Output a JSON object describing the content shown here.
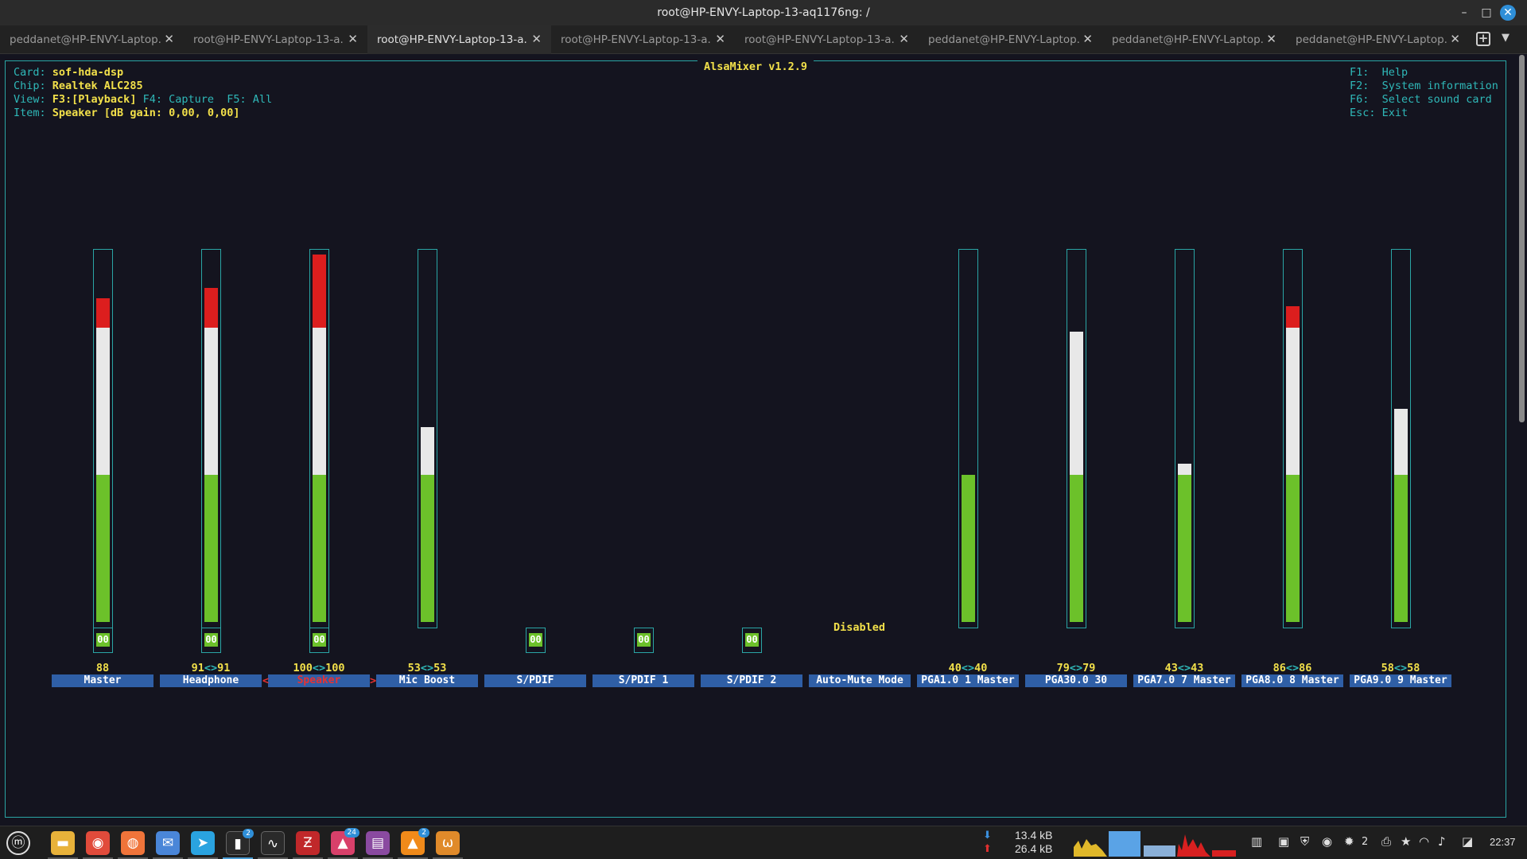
{
  "window": {
    "title": "root@HP-ENVY-Laptop-13-aq1176ng: /"
  },
  "tabs": [
    {
      "label": "peddanet@HP-ENVY-Laptop...",
      "active": false
    },
    {
      "label": "root@HP-ENVY-Laptop-13-a...",
      "active": false
    },
    {
      "label": "root@HP-ENVY-Laptop-13-a...",
      "active": true
    },
    {
      "label": "root@HP-ENVY-Laptop-13-a...",
      "active": false
    },
    {
      "label": "root@HP-ENVY-Laptop-13-a...",
      "active": false
    },
    {
      "label": "peddanet@HP-ENVY-Laptop...",
      "active": false
    },
    {
      "label": "peddanet@HP-ENVY-Laptop...",
      "active": false
    },
    {
      "label": "peddanet@HP-ENVY-Laptop...",
      "active": false
    }
  ],
  "mixer": {
    "title": "AlsaMixer v1.2.9",
    "card_label": "Card:",
    "card": "sof-hda-dsp",
    "chip_label": "Chip:",
    "chip": "Realtek ALC285",
    "view_label": "View:",
    "view_playback": "F3:[Playback]",
    "view_rest": " F4: Capture  F5: All",
    "item_label": "Item:",
    "item": "Speaker [dB gain: 0,00, 0,00]",
    "keys": [
      "F1:  Help",
      "F2:  System information",
      "F6:  Select sound card",
      "Esc: Exit"
    ],
    "disabled_text": "Disabled",
    "selected_arrows": {
      "left": "<",
      "right": ">"
    },
    "controls": [
      {
        "name": "Master",
        "volume": "88",
        "level": 88,
        "has_bar": true,
        "mute": "00",
        "selected": false
      },
      {
        "name": "Headphone",
        "volume_left": "91",
        "volume_right": "91",
        "level": 91,
        "has_bar": true,
        "mute": "00",
        "selected": false
      },
      {
        "name": "Speaker",
        "volume_left": "100",
        "volume_right": "100",
        "level": 100,
        "has_bar": true,
        "mute": "00",
        "selected": true
      },
      {
        "name": "Mic Boost",
        "volume_left": "53",
        "volume_right": "53",
        "level": 53,
        "has_bar": true,
        "selected": false
      },
      {
        "name": "S/PDIF",
        "has_bar": false,
        "mute": "00",
        "selected": false
      },
      {
        "name": "S/PDIF 1",
        "has_bar": false,
        "mute": "00",
        "selected": false
      },
      {
        "name": "S/PDIF 2",
        "has_bar": false,
        "mute": "00",
        "selected": false
      },
      {
        "name": "Auto-Mute Mode",
        "has_bar": false,
        "selected": false
      },
      {
        "name": "PGA1.0 1 Master",
        "volume_left": "40",
        "volume_right": "40",
        "level": 40,
        "has_bar": true,
        "selected": false
      },
      {
        "name": "PGA30.0 30",
        "volume_left": "79",
        "volume_right": "79",
        "level": 79,
        "has_bar": true,
        "selected": false
      },
      {
        "name": "PGA7.0 7 Master",
        "volume_left": "43",
        "volume_right": "43",
        "level": 43,
        "has_bar": true,
        "selected": false
      },
      {
        "name": "PGA8.0 8 Master",
        "volume_left": "86",
        "volume_right": "86",
        "level": 86,
        "has_bar": true,
        "selected": false
      },
      {
        "name": "PGA9.0 9 Master",
        "volume_left": "58",
        "volume_right": "58",
        "level": 58,
        "has_bar": true,
        "selected": false
      }
    ],
    "volume_separator": "<>"
  },
  "taskbar": {
    "apps": [
      {
        "icon": "menu-icon"
      },
      {
        "icon": "files-icon"
      },
      {
        "icon": "chrome-icon"
      },
      {
        "icon": "firefox-icon"
      },
      {
        "icon": "mail-icon"
      },
      {
        "icon": "telegram-icon"
      },
      {
        "icon": "terminal-icon",
        "badge": "2"
      },
      {
        "icon": "system-monitor-icon"
      },
      {
        "icon": "filezilla-icon"
      },
      {
        "icon": "image-viewer-icon",
        "badge": "24"
      },
      {
        "icon": "presentation-icon"
      },
      {
        "icon": "vlc-icon",
        "badge": "2"
      },
      {
        "icon": "app-icon"
      }
    ],
    "net_down": "13.4 kB",
    "net_up": "26.4 kB",
    "notification_count": "2",
    "clock": "22:37",
    "colors": {
      "accent": "#2f8fd8",
      "bar_green": "#6cc12a",
      "bar_red": "#dc1e1e"
    }
  }
}
